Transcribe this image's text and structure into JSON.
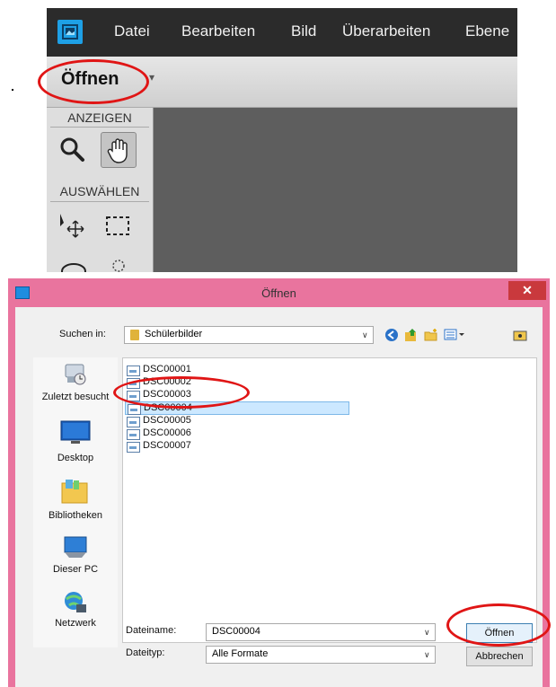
{
  "editor": {
    "menu": [
      "Datei",
      "Bearbeiten",
      "Bild",
      "Überarbeiten",
      "Ebene"
    ],
    "toolbar": {
      "open_label": "Öffnen",
      "open_arrow": "▾"
    },
    "panel": {
      "view_heading": "ANZEIGEN",
      "select_heading": "AUSWÄHLEN"
    }
  },
  "dialog": {
    "title": "Öffnen",
    "close_glyph": "✕",
    "look_in_label": "Suchen in:",
    "look_in_value": "Schülerbilder",
    "places": [
      "Zuletzt besucht",
      "Desktop",
      "Bibliotheken",
      "Dieser PC",
      "Netzwerk"
    ],
    "files": [
      "DSC00001",
      "DSC00002",
      "DSC00003",
      "DSC00004",
      "DSC00005",
      "DSC00006",
      "DSC00007"
    ],
    "selected_file": "DSC00004",
    "filename_label": "Dateiname:",
    "filename_value": "DSC00004",
    "filetype_label": "Dateityp:",
    "filetype_value": "Alle Formate",
    "open_button": "Öffnen",
    "cancel_button": "Abbrechen",
    "dropdown_glyph": "∨"
  },
  "colors": {
    "annotation": "#e01515",
    "dialog_frame": "#e9749e",
    "selection": "#cce8ff",
    "app_accent": "#1ea0e6"
  }
}
